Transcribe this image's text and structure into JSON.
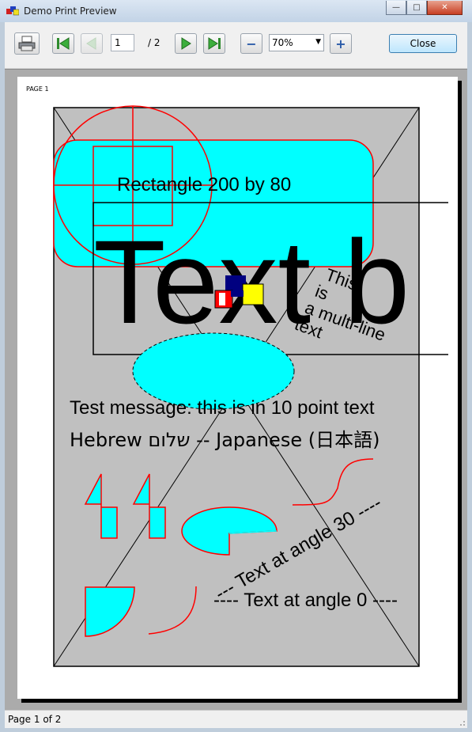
{
  "window": {
    "title": "Demo Print Preview",
    "minimize_glyph": "—",
    "maximize_glyph": "□",
    "close_glyph": "✕"
  },
  "toolbar": {
    "print_icon": "printer-icon",
    "first_icon": "first-page-icon",
    "prev_icon": "previous-page-icon",
    "next_icon": "next-page-icon",
    "last_icon": "last-page-icon",
    "current_page": "1",
    "page_total": "/ 2",
    "zoom_out_glyph": "−",
    "zoom_value": "70%",
    "zoom_in_glyph": "+",
    "close_label": "Close"
  },
  "page": {
    "label": "PAGE 1",
    "rect_text": "Rectangle 200 by  80",
    "big_text": "Text b",
    "multiline": [
      "This",
      "is",
      "a multi-line",
      "text"
    ],
    "test_message": "Test message: this is in 10 point text",
    "hebrew_line": "Hebrew     שלום -- Japanese (日本語)",
    "angle30_text": "--- Text at angle 30 ----",
    "angle0_text": "---- Text at angle 0 ----",
    "colors": {
      "fill_cyan": "#00ffff",
      "stroke_red": "#ff0000",
      "page_bg": "#c0c0c0"
    }
  },
  "status": {
    "text": "Page 1 of 2"
  }
}
